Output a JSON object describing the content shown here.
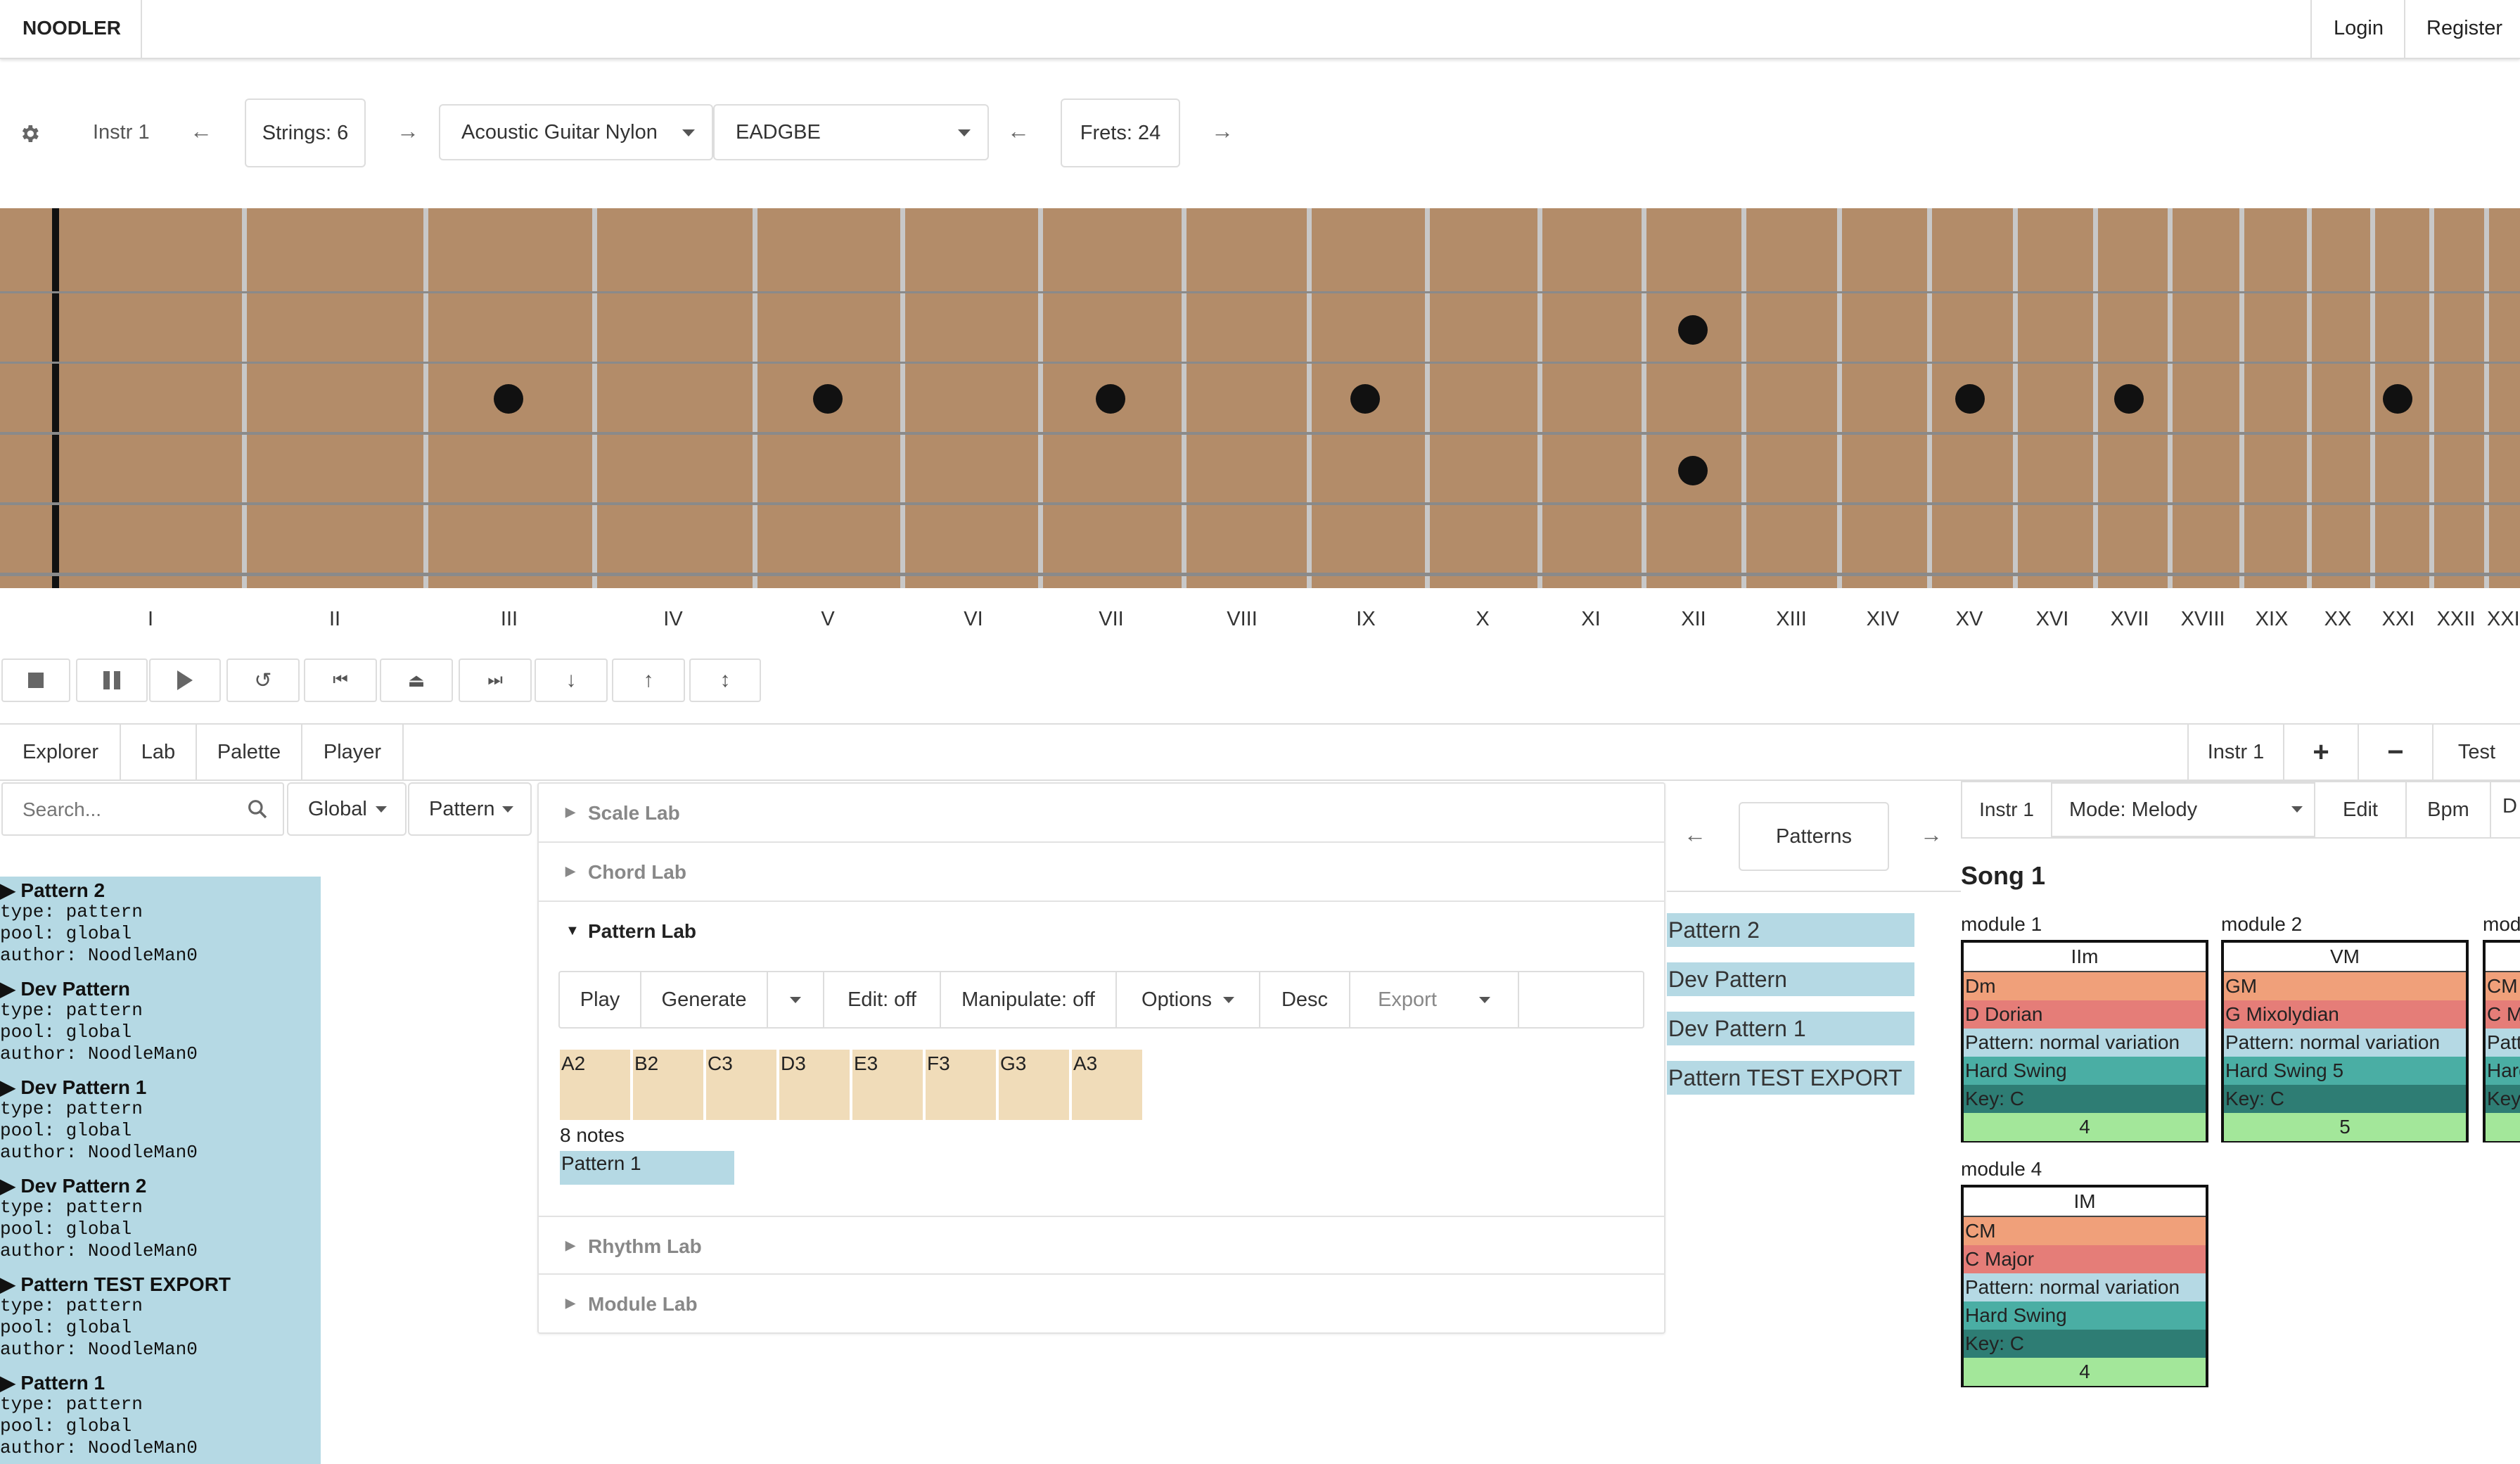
{
  "navbar": {
    "brand": "NOODLER",
    "login": "Login",
    "register": "Register"
  },
  "instrument_bar": {
    "instrument": "Instr 1",
    "strings": "Strings: 6",
    "sound": "Acoustic Guitar Nylon",
    "tuning": "EADGBE",
    "frets": "Frets: 24"
  },
  "fret_numbers": [
    "I",
    "II",
    "III",
    "IV",
    "V",
    "VI",
    "VII",
    "VIII",
    "IX",
    "X",
    "XI",
    "XII",
    "XIII",
    "XIV",
    "XV",
    "XVI",
    "XVII",
    "XVIII",
    "XIX",
    "XX",
    "XXI",
    "XXII",
    "XXIII"
  ],
  "fret_numbers_partial_last": "XXI",
  "transport": [
    "stop-icon",
    "pause-icon",
    "play-icon",
    "loop-icon",
    "skip-back-icon",
    "eject-icon",
    "skip-forward-icon",
    "arrow-down-icon",
    "arrow-up-icon",
    "arrow-updown-icon"
  ],
  "tabs": {
    "explorer": "Explorer",
    "lab": "Lab",
    "palette": "Palette",
    "player": "Player"
  },
  "right_tabs": {
    "instrument": "Instr 1",
    "add": "+",
    "remove": "−",
    "test": "Test"
  },
  "explorer": {
    "search_placeholder": "Search...",
    "scope": "Global",
    "type": "Pattern",
    "items": [
      {
        "title": "Pattern 2",
        "type": "type: pattern",
        "pool": "pool: global",
        "author": "author: NoodleMan0"
      },
      {
        "title": "Dev Pattern",
        "type": "type: pattern",
        "pool": "pool: global",
        "author": "author: NoodleMan0"
      },
      {
        "title": "Dev Pattern 1",
        "type": "type: pattern",
        "pool": "pool: global",
        "author": "author: NoodleMan0"
      },
      {
        "title": "Dev Pattern 2",
        "type": "type: pattern",
        "pool": "pool: global",
        "author": "author: NoodleMan0"
      },
      {
        "title": "Pattern TEST EXPORT",
        "type": "type: pattern",
        "pool": "pool: global",
        "author": "author: NoodleMan0"
      },
      {
        "title": "Pattern 1",
        "type": "type: pattern",
        "pool": "pool: global",
        "author": "author: NoodleMan0"
      }
    ]
  },
  "lab": {
    "scale_lab": "Scale Lab",
    "chord_lab": "Chord Lab",
    "pattern_lab": "Pattern Lab",
    "rhythm_lab": "Rhythm Lab",
    "module_lab": "Module Lab",
    "toolbar": {
      "play": "Play",
      "generate": "Generate",
      "edit": "Edit: off",
      "manipulate": "Manipulate: off",
      "options": "Options",
      "desc": "Desc",
      "export": "Export"
    },
    "notes": [
      "A2",
      "B2",
      "C3",
      "D3",
      "E3",
      "F3",
      "G3",
      "A3"
    ],
    "note_count": "8 notes",
    "pattern_name": "Pattern 1"
  },
  "patterns_panel": {
    "title": "Patterns",
    "items": [
      "Pattern 2",
      "Dev Pattern",
      "Dev Pattern 1",
      "Pattern TEST EXPORT"
    ]
  },
  "song": {
    "instrument": "Instr 1",
    "mode": "Mode: Melody",
    "edit": "Edit",
    "bpm": "Bpm",
    "partial": "D",
    "title": "Song 1",
    "modules": [
      {
        "label": "module 1",
        "chord": "IIm",
        "name": "Dm",
        "scale": "D Dorian",
        "pattern": "Pattern: normal variation",
        "rhythm": "Hard Swing",
        "key": "Key: C",
        "count": "4"
      },
      {
        "label": "module 2",
        "chord": "VM",
        "name": "GM",
        "scale": "G Mixolydian",
        "pattern": "Pattern: normal variation",
        "rhythm": "Hard Swing 5",
        "key": "Key: C",
        "count": "5"
      },
      {
        "label": "mod",
        "chord": "",
        "name": "CM",
        "scale": "C M",
        "pattern": "Patt",
        "rhythm": "Hard",
        "key": "Key",
        "count": ""
      },
      {
        "label": "module 4",
        "chord": "IM",
        "name": "CM",
        "scale": "C Major",
        "pattern": "Pattern: normal variation",
        "rhythm": "Hard Swing",
        "key": "Key: C",
        "count": "4"
      }
    ]
  },
  "colors": {
    "fretboard": "#b38c69",
    "chord_name": "#f0a07a",
    "scale": "#e57d78",
    "pattern": "#b5d9e4",
    "rhythm": "#4aaea4",
    "key": "#2e7d74",
    "count": "#a3e79a",
    "explorer_item": "#b5d9e4",
    "note": "#f0dcb9"
  }
}
